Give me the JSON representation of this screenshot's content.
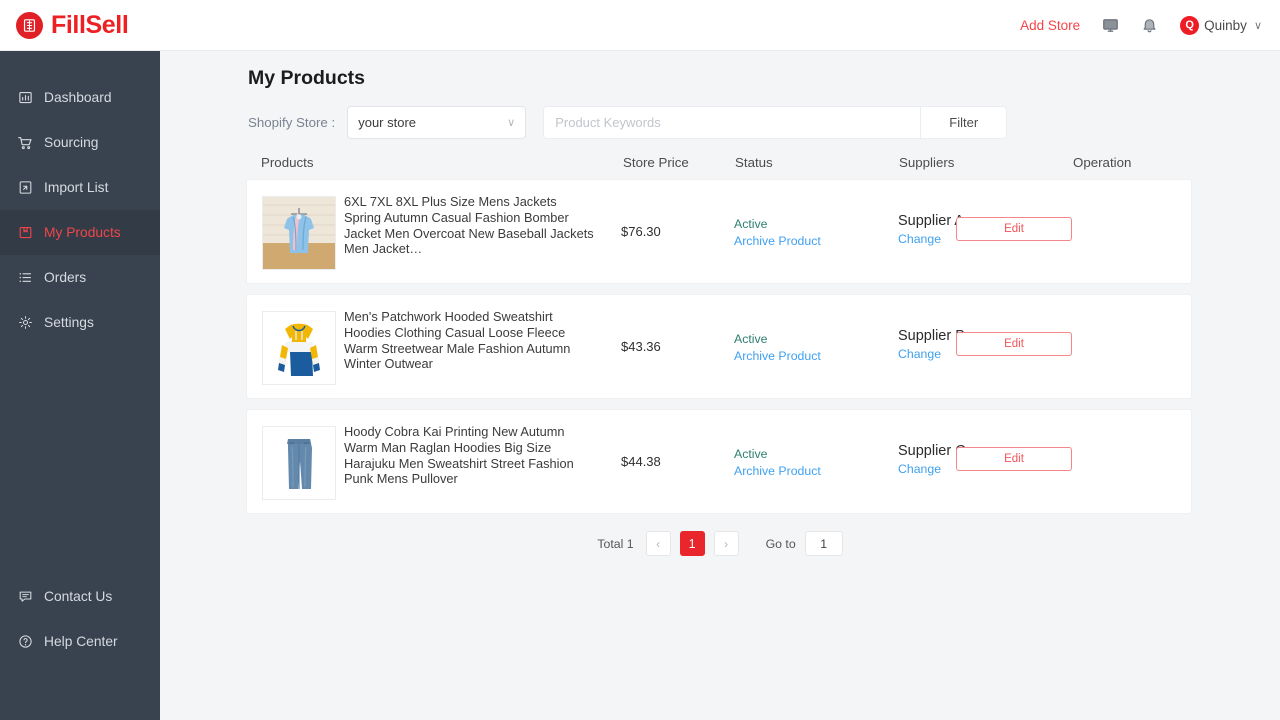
{
  "brand": {
    "name": "FillSell",
    "mark_icon": "fillsell-logo-icon"
  },
  "header": {
    "add_store": "Add Store",
    "monitor_icon": "monitor-icon",
    "bell_icon": "bell-icon",
    "user": {
      "initial": "Q",
      "name": "Quinby",
      "caret": "∨"
    },
    "accent_red": "#ed2024"
  },
  "sidebar": {
    "bg": "#39434f",
    "active_color": "#f0464b",
    "items": [
      {
        "label": "Dashboard",
        "icon": "dashboard-icon",
        "active": false
      },
      {
        "label": "Sourcing",
        "icon": "cart-icon",
        "active": false
      },
      {
        "label": "Import List",
        "icon": "import-file-icon",
        "active": false
      },
      {
        "label": "My Products",
        "icon": "box-icon",
        "active": true
      },
      {
        "label": "Orders",
        "icon": "list-icon",
        "active": false
      },
      {
        "label": "Settings",
        "icon": "gear-icon",
        "active": false
      }
    ],
    "bottom_items": [
      {
        "label": "Contact Us",
        "icon": "chat-icon"
      },
      {
        "label": "Help Center",
        "icon": "question-circle-icon"
      }
    ]
  },
  "main": {
    "title": "My Products",
    "filters": {
      "store_label": "Shopify Store :",
      "store_value": "your store",
      "store_caret": "∨",
      "search_placeholder": "Product Keywords",
      "search_value": "",
      "filter_button": "Filter"
    },
    "columns": {
      "products": "Products",
      "price": "Store Price",
      "status": "Status",
      "suppliers": "Suppliers",
      "operation": "Operation"
    },
    "rows": [
      {
        "title": "6XL 7XL 8XL Plus Size Mens Jackets Spring Autumn Casual Fashion Bomber Jacket Men Overcoat New Baseball Jackets Men Jacket…",
        "price": "$76.30",
        "status": "Active",
        "archive": "Archive Product",
        "supplier": "Supplier A",
        "change": "Change",
        "edit": "Edit",
        "thumb": "blue-jacket-on-hanger"
      },
      {
        "title": "Men's Patchwork Hooded Sweatshirt Hoodies Clothing Casual Loose Fleece Warm Streetwear Male Fashion Autumn Winter Outwear",
        "price": "$43.36",
        "status": "Active",
        "archive": "Archive Product",
        "supplier": "Supplier B",
        "change": "Change",
        "edit": "Edit",
        "thumb": "yellow-white-blue-hoodie"
      },
      {
        "title": "Hoody Cobra Kai Printing New Autumn Warm Man Raglan Hoodies Big Size Harajuku Men Sweatshirt Street Fashion Punk Mens Pullover",
        "price": "$44.38",
        "status": "Active",
        "archive": "Archive Product",
        "supplier": "Supplier C",
        "change": "Change",
        "edit": "Edit",
        "thumb": "blue-denim-jeans"
      }
    ],
    "pagination": {
      "total": "Total 1",
      "prev": "‹",
      "current_page": "1",
      "next": "›",
      "goto_label": "Go to",
      "goto_value": "1"
    }
  }
}
